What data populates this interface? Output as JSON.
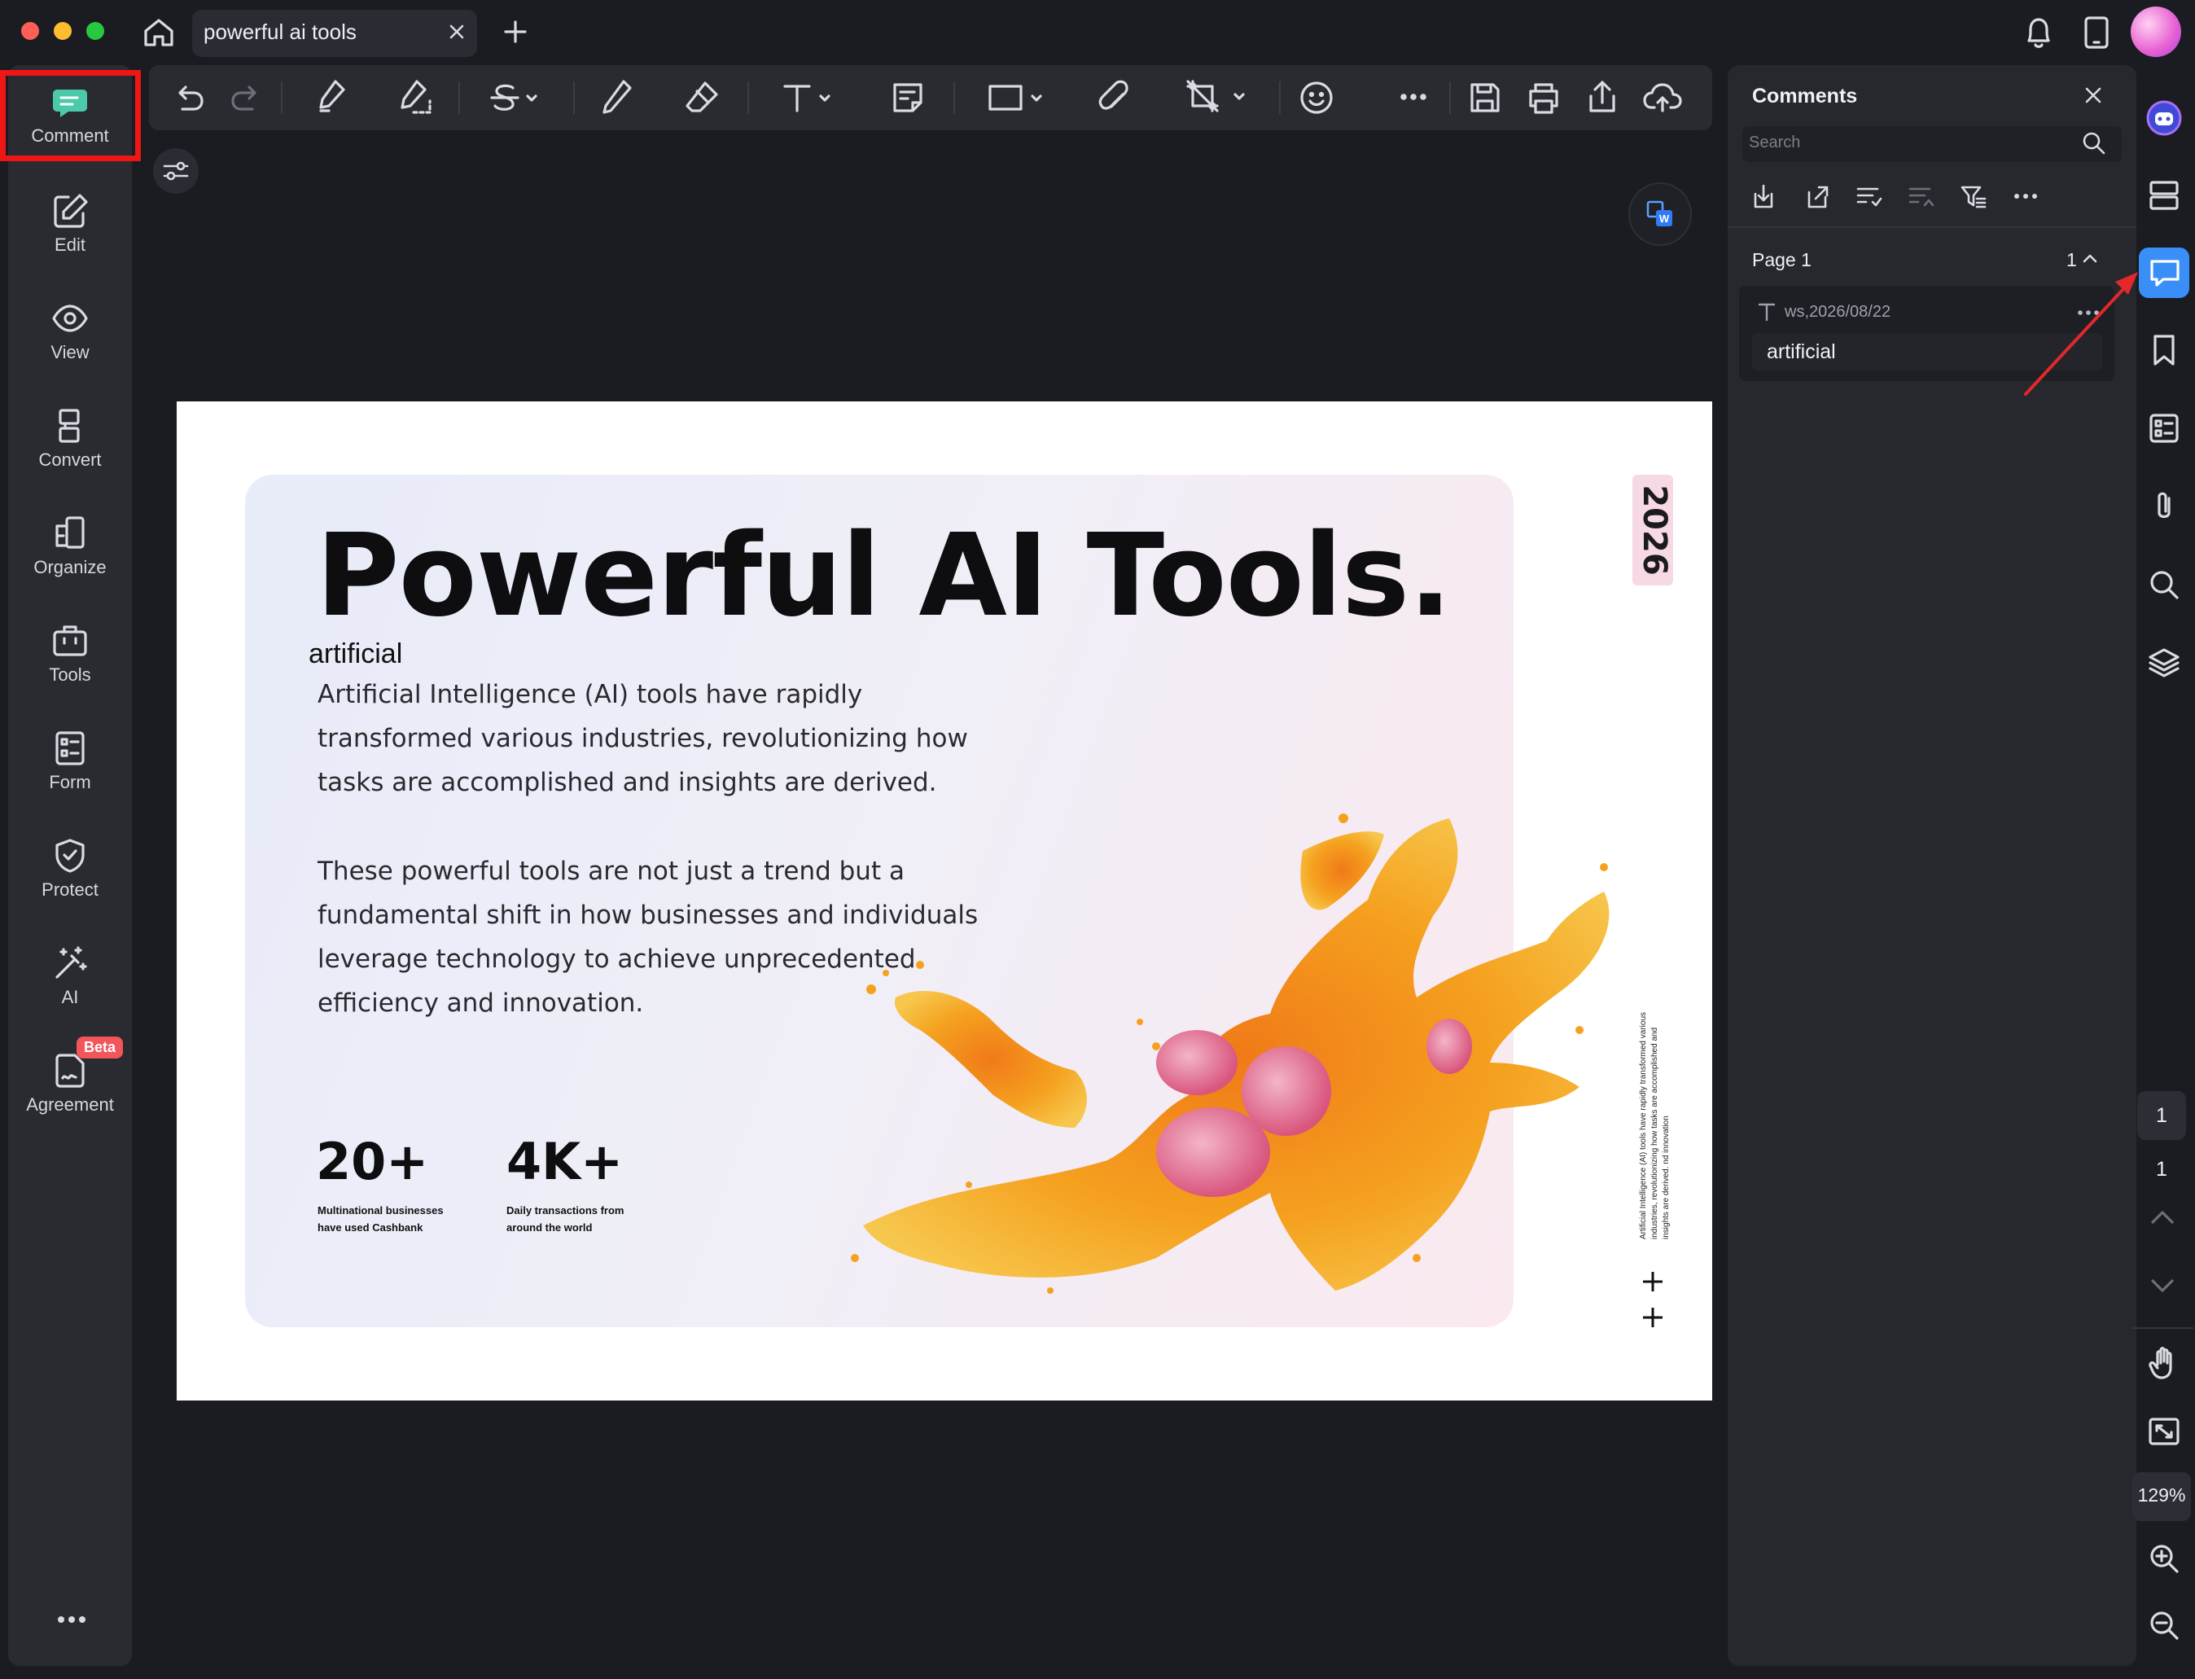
{
  "window": {
    "tab_title": "powerful ai tools"
  },
  "sidebar": {
    "items": [
      {
        "label": "Comment",
        "icon": "comment-icon"
      },
      {
        "label": "Edit",
        "icon": "edit-icon"
      },
      {
        "label": "View",
        "icon": "eye-icon"
      },
      {
        "label": "Convert",
        "icon": "convert-icon"
      },
      {
        "label": "Organize",
        "icon": "organize-icon"
      },
      {
        "label": "Tools",
        "icon": "toolbox-icon"
      },
      {
        "label": "Form",
        "icon": "form-icon"
      },
      {
        "label": "Protect",
        "icon": "shield-icon"
      },
      {
        "label": "AI",
        "icon": "magic-wand-icon"
      },
      {
        "label": "Agreement",
        "icon": "agreement-icon"
      }
    ],
    "beta_badge": "Beta",
    "accent_color": "#4cc9a8",
    "highlight_color": "#f01616"
  },
  "document": {
    "title": "Powerful AI Tools.",
    "annotation_text": "artificial",
    "paragraph1": "Artificial Intelligence (AI) tools have rapidly transformed various industries, revolutionizing how tasks are accomplished and insights are derived.",
    "paragraph2": "These powerful tools are not just a trend but a fundamental shift in how businesses and individuals leverage technology to achieve unprecedented efficiency and innovation.",
    "stats": [
      {
        "value": "20+",
        "caption_line1": "Multinational businesses",
        "caption_line2": "have used Cashbank"
      },
      {
        "value": "4K+",
        "caption_line1": "Daily transactions from",
        "caption_line2": "around the world"
      }
    ],
    "year": "2026",
    "side_note_lines": [
      "Artificial Intelligence (AI) tools have rapidly transformed various",
      "industries, revolutionizing how tasks are accomplished and",
      "insights are derived. nd innovation"
    ]
  },
  "comments_panel": {
    "title": "Comments",
    "search_placeholder": "Search",
    "page_label": "Page 1",
    "page_count": "1",
    "comment": {
      "meta": "ws,2026/08/22",
      "text": "artificial"
    }
  },
  "right_rail": {
    "current_page": "1",
    "total_pages": "1",
    "zoom": "129%",
    "active_color": "#3a8ef8"
  }
}
